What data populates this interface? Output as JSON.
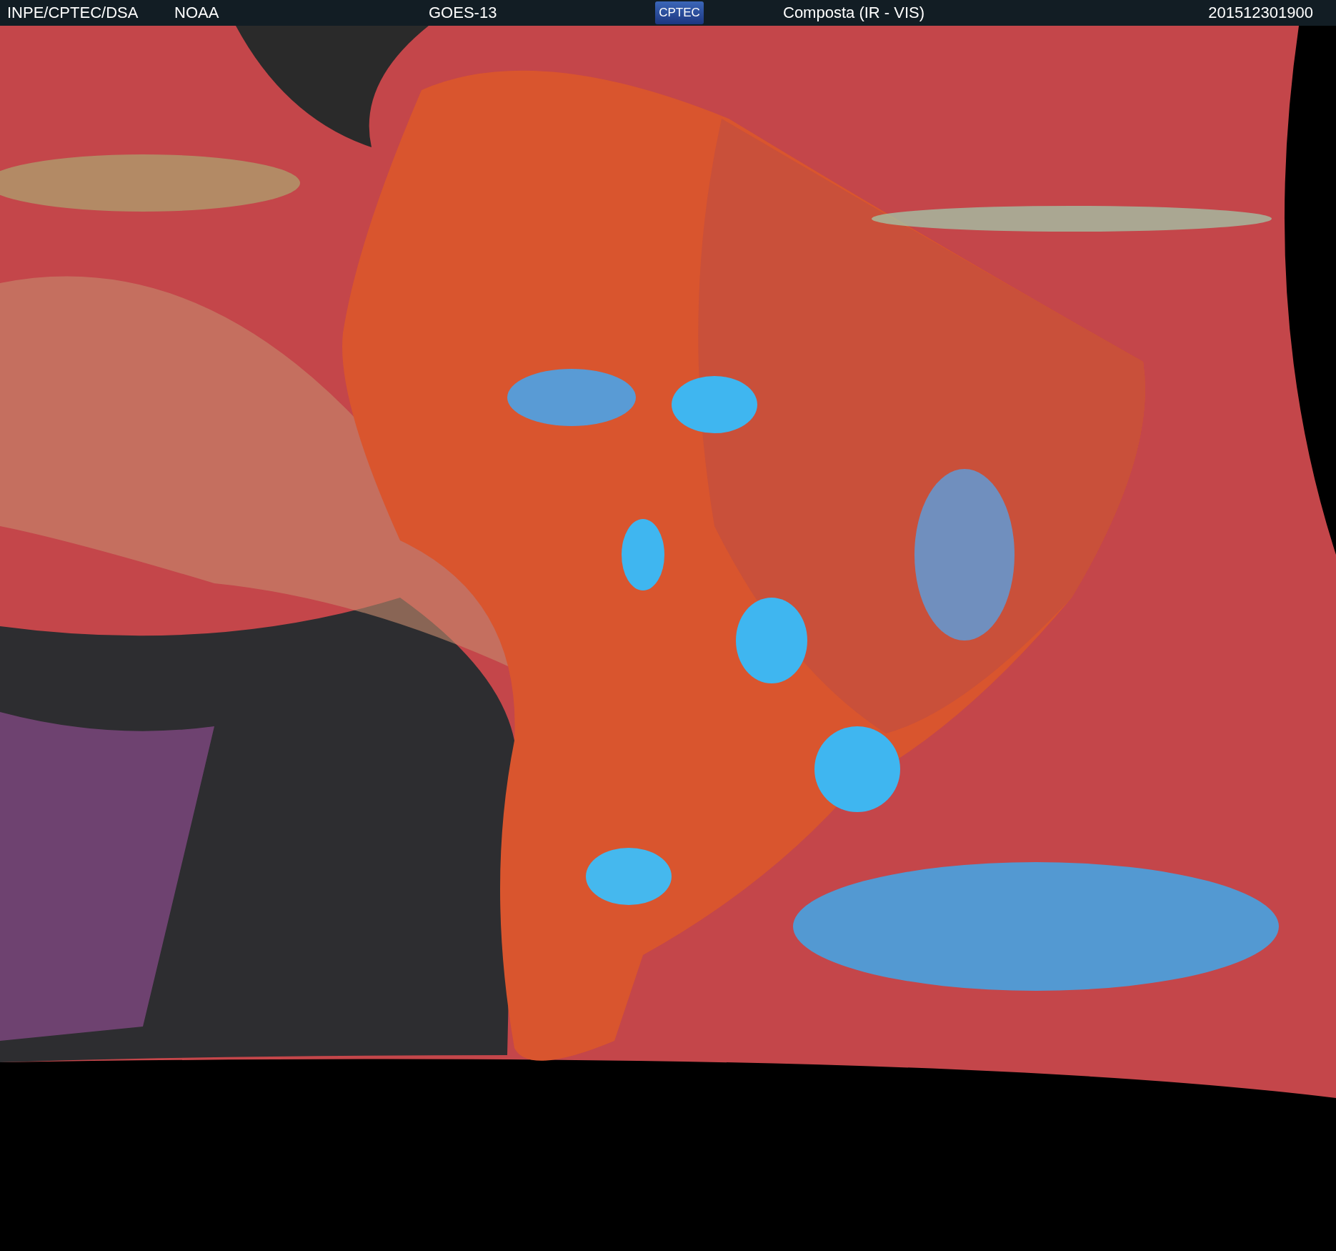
{
  "header": {
    "source": "INPE/CPTEC/DSA",
    "agency": "NOAA",
    "satellite": "GOES-13",
    "logo": "CPTEC",
    "product": "Composta (IR - VIS)",
    "timestamp": "201512301900"
  }
}
